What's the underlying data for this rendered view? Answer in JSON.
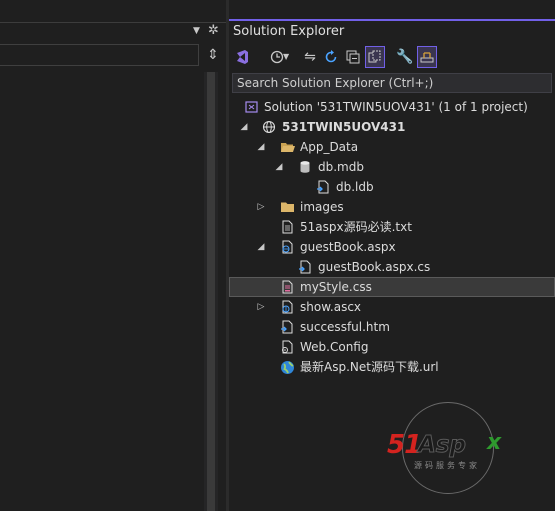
{
  "left_pane": {
    "dropdown_icon": "chevron-down-icon",
    "gear_icon": "gear-icon",
    "split_icon": "split-icon"
  },
  "solution_explorer": {
    "title": "Solution Explorer",
    "accent_color": "#7160e8",
    "search_placeholder": "Search Solution Explorer (Ctrl+;)",
    "toolbar": [
      {
        "icon": "vs-switch-views-icon"
      },
      {
        "icon": "history-icon"
      },
      {
        "icon": "sync-icon"
      },
      {
        "icon": "refresh-icon"
      },
      {
        "icon": "collapse-all-icon"
      },
      {
        "icon": "show-all-files-icon"
      },
      {
        "icon": "properties-wrench-icon"
      },
      {
        "icon": "preview-icon"
      }
    ],
    "tree": [
      {
        "label": "Solution '531TWIN5UOV431' (1 of 1 project)",
        "icon": "solution-icon",
        "expander": ""
      },
      {
        "label": "531TWIN5UOV431",
        "icon": "website-icon",
        "expander": "expanded"
      },
      {
        "label": "App_Data",
        "icon": "folder-open-icon",
        "expander": "expanded"
      },
      {
        "label": "db.mdb",
        "icon": "database-icon",
        "expander": "expanded"
      },
      {
        "label": "db.ldb",
        "icon": "file-icon",
        "expander": ""
      },
      {
        "label": "images",
        "icon": "folder-icon",
        "expander": "collapsed"
      },
      {
        "label": "51aspx源码必读.txt",
        "icon": "text-file-icon",
        "expander": ""
      },
      {
        "label": "guestBook.aspx",
        "icon": "aspx-file-icon",
        "expander": "expanded"
      },
      {
        "label": "guestBook.aspx.cs",
        "icon": "cs-file-icon",
        "expander": ""
      },
      {
        "label": "myStyle.css",
        "icon": "css-file-icon",
        "expander": "",
        "selected": true
      },
      {
        "label": "show.ascx",
        "icon": "ascx-file-icon",
        "expander": "collapsed"
      },
      {
        "label": "successful.htm",
        "icon": "html-file-icon",
        "expander": ""
      },
      {
        "label": "Web.Config",
        "icon": "config-file-icon",
        "expander": ""
      },
      {
        "label": "最新Asp.Net源码下载.url",
        "icon": "globe-icon",
        "expander": ""
      }
    ]
  },
  "watermark": {
    "brand_51": "51",
    "brand_asp": "Asp",
    "brand_x": "x",
    "subtitle": "源码服务专家"
  }
}
